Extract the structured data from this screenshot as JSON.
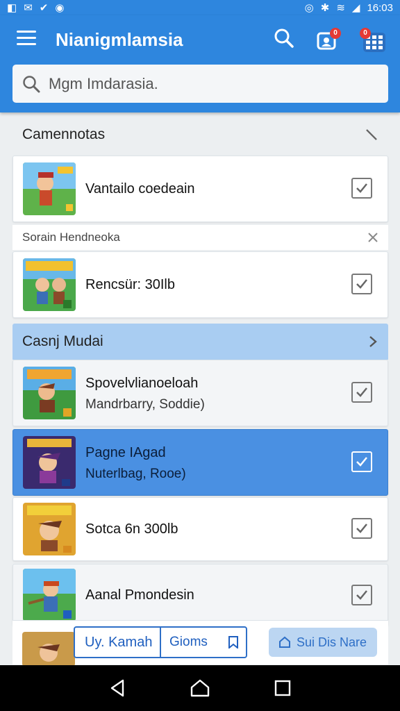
{
  "status_bar": {
    "time": "16:03",
    "left_glyphs": [
      "◧",
      "✉",
      "✔",
      "◉"
    ],
    "right_glyphs": [
      "◎",
      "✱",
      "≋",
      "◢"
    ]
  },
  "app_bar": {
    "title": "Nianigmlamsia",
    "notification_count": "0",
    "grid_count": "0"
  },
  "search": {
    "placeholder": "Mgm Imdarasia."
  },
  "sections": [
    {
      "label": "Camennotas",
      "icon": "chevron-close-icon"
    },
    {
      "label": "Sorain Hendneoka",
      "icon": "close-icon"
    },
    {
      "label": "Casnj Mudai",
      "icon": "chevron-right-icon"
    }
  ],
  "rows": [
    {
      "title": "Vantailo coedeain",
      "sub": "",
      "checked": true
    },
    {
      "title": "Rencsür: 30Ilb",
      "sub": "",
      "checked": true
    },
    {
      "title": "Spovelvlianoeloah",
      "sub": "Mandrbarry, Soddie)",
      "checked": true
    },
    {
      "title": "Pagne IAgad",
      "sub": "Nuterlbag, Rooe)",
      "checked": true
    },
    {
      "title": "Sotca 6n 300lb",
      "sub": "",
      "checked": true
    },
    {
      "title": "Aanal Pmondesin",
      "sub": "",
      "checked": true
    }
  ],
  "bottom_actions": {
    "left_primary": "Uy. Kamah",
    "left_secondary": "Gioms",
    "right_label": "Sui Dis Nare"
  },
  "colors": {
    "primary": "#2e86de",
    "selected": "#4a90e2",
    "section_highlight": "#a9cdf2"
  }
}
